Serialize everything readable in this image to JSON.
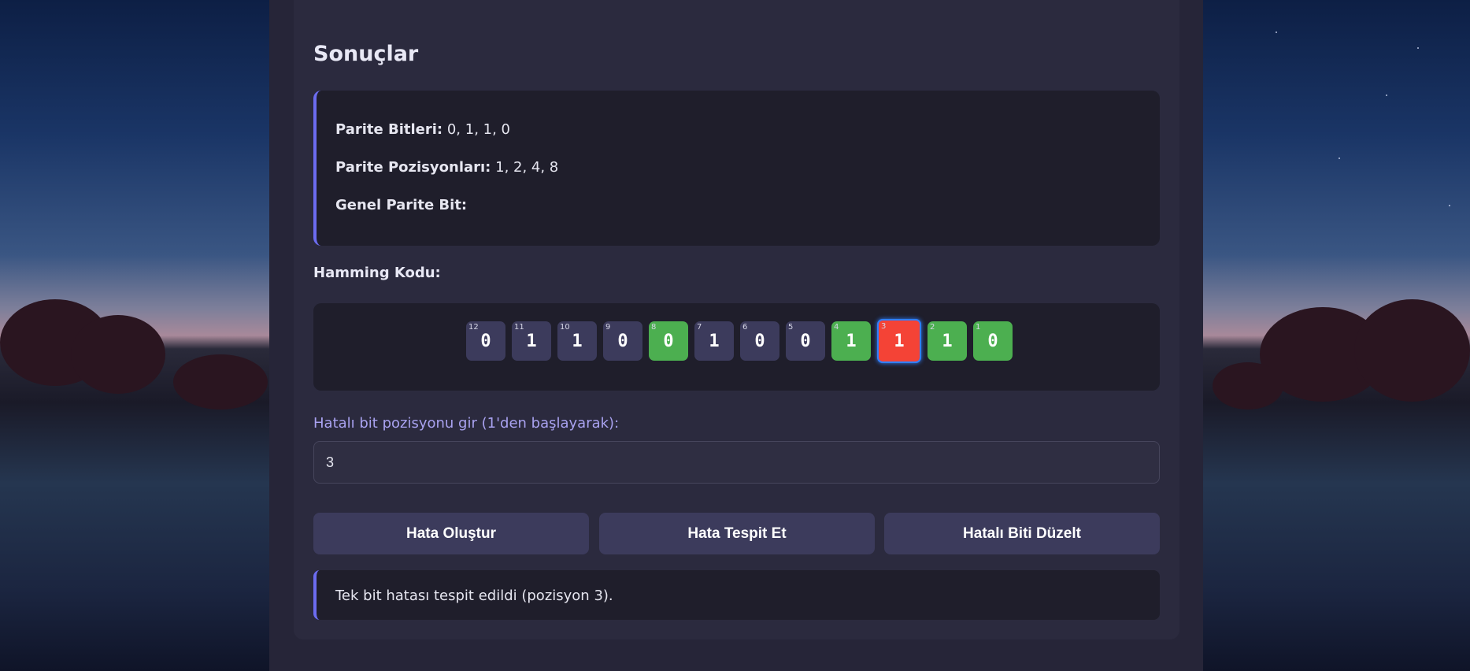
{
  "results": {
    "title": "Sonuçlar",
    "parity_bits_label": "Parite Bitleri:",
    "parity_bits_value": "0, 1, 1, 0",
    "parity_positions_label": "Parite Pozisyonları:",
    "parity_positions_value": "1, 2, 4, 8",
    "overall_parity_label": "Genel Parite Bit:",
    "overall_parity_value": ""
  },
  "hamming": {
    "label": "Hamming Kodu:",
    "bits": [
      {
        "pos": "12",
        "value": "0",
        "type": "data"
      },
      {
        "pos": "11",
        "value": "1",
        "type": "data"
      },
      {
        "pos": "10",
        "value": "1",
        "type": "data"
      },
      {
        "pos": "9",
        "value": "0",
        "type": "data"
      },
      {
        "pos": "8",
        "value": "0",
        "type": "parity"
      },
      {
        "pos": "7",
        "value": "1",
        "type": "data"
      },
      {
        "pos": "6",
        "value": "0",
        "type": "data"
      },
      {
        "pos": "5",
        "value": "0",
        "type": "data"
      },
      {
        "pos": "4",
        "value": "1",
        "type": "parity"
      },
      {
        "pos": "3",
        "value": "1",
        "type": "error"
      },
      {
        "pos": "2",
        "value": "1",
        "type": "parity"
      },
      {
        "pos": "1",
        "value": "0",
        "type": "parity"
      }
    ]
  },
  "error_input": {
    "label": "Hatalı bit pozisyonu gir (1'den başlayarak):",
    "value": "3"
  },
  "buttons": {
    "create_error": "Hata Oluştur",
    "detect_error": "Hata Tespit Et",
    "fix_error": "Hatalı Biti Düzelt"
  },
  "status": {
    "message": "Tek bit hatası tespit edildi (pozisyon 3)."
  },
  "colors": {
    "accent": "#6c6cf0",
    "parity_bit": "#4caf50",
    "error_bit": "#f44336",
    "data_bit": "#3c3b5c"
  }
}
